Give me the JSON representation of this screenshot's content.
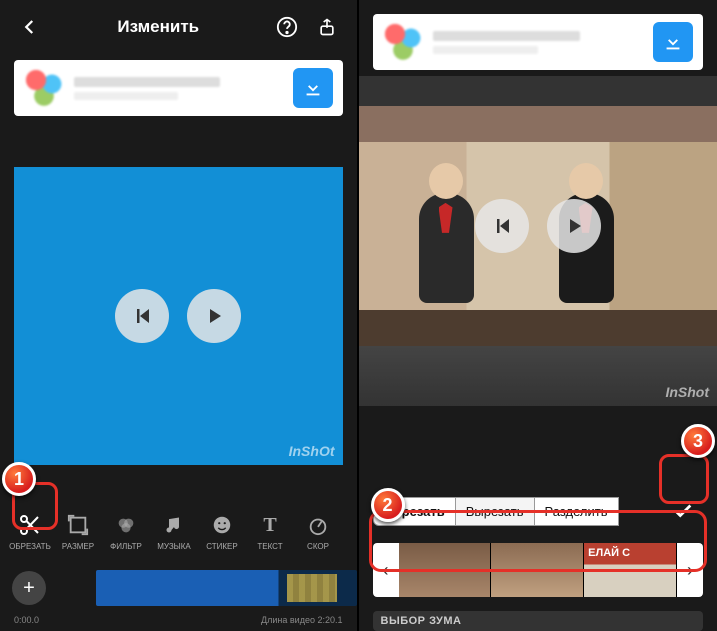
{
  "left": {
    "header": {
      "title": "Изменить"
    },
    "watermark": "InShOt",
    "tools": [
      {
        "label": "ОБРЕЗАТЬ"
      },
      {
        "label": "РАЗМЕР"
      },
      {
        "label": "ФИЛЬТР"
      },
      {
        "label": "МУЗЫКА"
      },
      {
        "label": "СТИКЕР"
      },
      {
        "label": "ТЕКСТ"
      },
      {
        "label": "СКОР"
      }
    ],
    "time_start": "0:00.0",
    "duration_label": "Длина видео 2:20.1"
  },
  "right": {
    "watermark": "InShot",
    "segments": {
      "trim": "Обрезать",
      "cut": "Вырезать",
      "split": "Разделить"
    },
    "zoom_label": "ВЫБОР ЗУМА"
  },
  "badges": {
    "one": "1",
    "two": "2",
    "three": "3"
  }
}
